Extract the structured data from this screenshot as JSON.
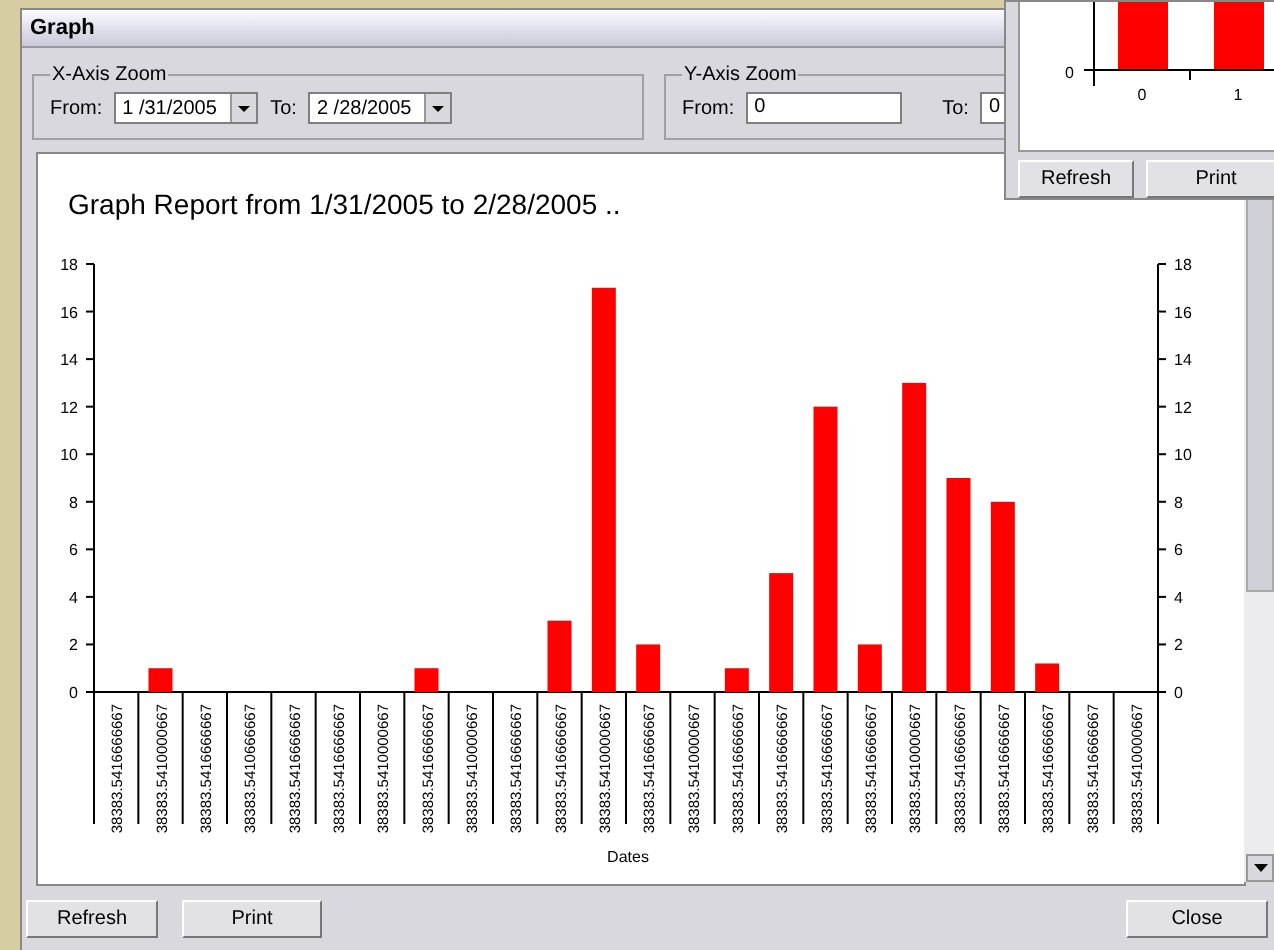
{
  "window": {
    "title": "Graph"
  },
  "x_axis_zoom": {
    "legend": "X-Axis Zoom",
    "from_label": "From:",
    "from_value": "1 /31/2005",
    "to_label": "To:",
    "to_value": "2 /28/2005"
  },
  "y_axis_zoom": {
    "legend": "Y-Axis Zoom",
    "from_label": "From:",
    "from_value": "0",
    "to_label": "To:",
    "to_value": "0"
  },
  "chart_data": {
    "type": "bar",
    "title": "Graph Report from 1/31/2005 to 2/28/2005 ..",
    "xlabel": "Dates",
    "categories": [
      "38383.5416666667",
      "38383.5410000667",
      "38383.5416666667",
      "38383.5410666667",
      "38383.5416666667",
      "38383.5416666667",
      "38383.5410000667",
      "38383.5416666667",
      "38383.5410000667",
      "38383.5416666667",
      "38383.5416666667",
      "38383.5410000667",
      "38383.5416666667",
      "38383.5410000667",
      "38383.5416666667",
      "38383.5416666667",
      "38383.5416666667",
      "38383.5416666667",
      "38383.5410000667",
      "38383.5416666667",
      "38383.5416666667",
      "38383.5416666667",
      "38383.5416666667",
      "38383.5410000667"
    ],
    "series": [
      {
        "color": "#ff0000",
        "values": [
          0,
          1,
          0,
          0,
          0,
          0,
          0,
          1,
          0,
          0,
          3,
          17,
          2,
          0,
          1,
          5,
          12,
          2,
          13,
          9,
          8,
          1.2,
          0,
          0
        ]
      }
    ],
    "ylim": [
      0,
      18
    ],
    "yticks": [
      0,
      2,
      4,
      6,
      8,
      10,
      12,
      14,
      16,
      18
    ]
  },
  "left_axis_ticks": [
    "18",
    "16",
    "14",
    "12",
    "10",
    "8",
    "6",
    "4",
    "2",
    "0"
  ],
  "buttons": [
    "Refresh",
    "Print",
    "Close"
  ],
  "popup": {
    "y_tick": "0",
    "x_ticks": [
      "0",
      "1"
    ],
    "buttons": [
      "Refresh",
      "Print"
    ]
  }
}
